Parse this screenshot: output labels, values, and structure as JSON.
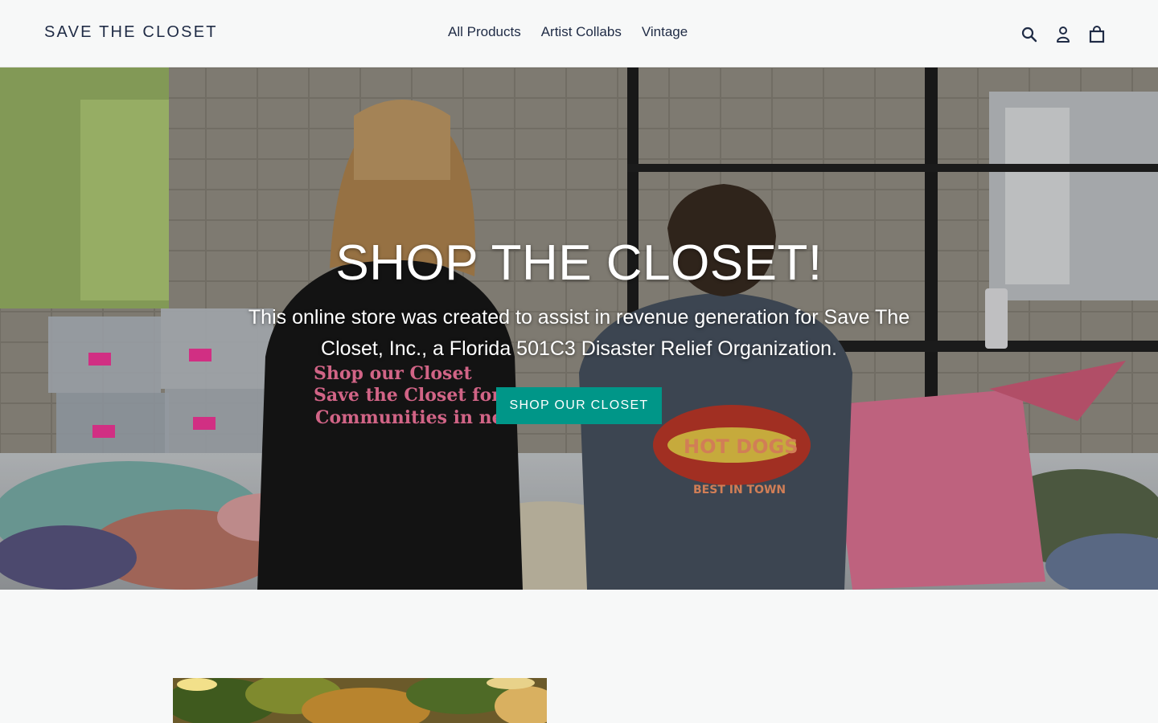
{
  "header": {
    "logo": "SAVE THE CLOSET",
    "nav": [
      {
        "label": "All Products"
      },
      {
        "label": "Artist Collabs"
      },
      {
        "label": "Vintage"
      }
    ],
    "icons": [
      "search-icon",
      "account-icon",
      "cart-icon"
    ]
  },
  "hero": {
    "title": "SHOP THE CLOSET!",
    "subtitle": "This online store was created to assist in revenue generation for Save The Closet, Inc., a Florida 501C3 Disaster Relief Organization.",
    "button_label": "SHOP OUR CLOSET",
    "background": "photo of two volunteers sorting donated clothing"
  },
  "colors": {
    "accent": "#009688",
    "nav_text": "#1f2b45",
    "header_bg": "#f7f8f8"
  }
}
